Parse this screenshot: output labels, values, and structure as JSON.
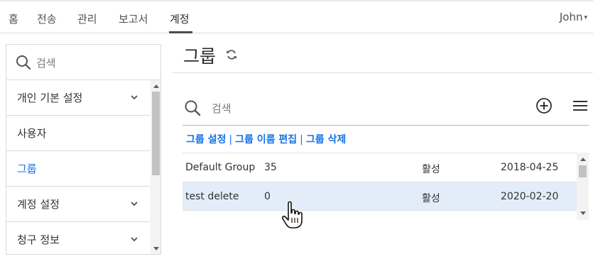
{
  "topnav": {
    "tabs": [
      {
        "label": "홈"
      },
      {
        "label": "전송"
      },
      {
        "label": "관리"
      },
      {
        "label": "보고서"
      },
      {
        "label": "계정"
      }
    ],
    "active_tab": "계정",
    "user": "John"
  },
  "sidebar": {
    "search_placeholder": "검색",
    "items": [
      {
        "label": "개인 기본 설정",
        "expandable": true
      },
      {
        "label": "사용자",
        "expandable": false
      },
      {
        "label": "그룹",
        "expandable": false,
        "active": true
      },
      {
        "label": "계정 설정",
        "expandable": true
      },
      {
        "label": "청구 정보",
        "expandable": true
      }
    ]
  },
  "main": {
    "title": "그룹",
    "search_placeholder": "검색",
    "actions": [
      "그룹 설정",
      "그룹 이름 편집",
      "그룹 삭제"
    ],
    "action_separator": "|",
    "rows": [
      {
        "name": "Default Group",
        "count": "35",
        "status": "활성",
        "date": "2018-04-25",
        "selected": false
      },
      {
        "name": "test delete",
        "count": "0",
        "status": "활성",
        "date": "2020-02-20",
        "selected": true
      }
    ]
  },
  "colors": {
    "accent": "#1473e6",
    "selected_row": "#e2edf9",
    "border": "#dadada"
  },
  "icons": [
    "search-icon",
    "chevron-down-icon",
    "refresh-icon",
    "add-circle-icon",
    "hamburger-menu-icon",
    "hand-pointer-cursor"
  ]
}
